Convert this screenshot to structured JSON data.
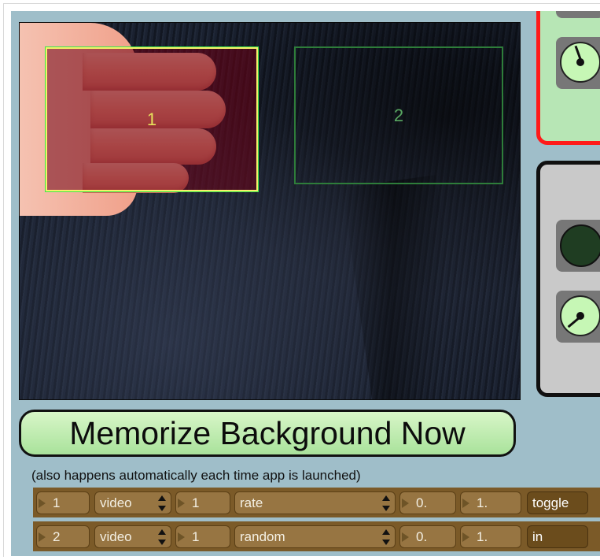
{
  "zones": [
    {
      "label": "1"
    },
    {
      "label": "2"
    }
  ],
  "memorize_button": {
    "label": "Memorize Background Now"
  },
  "note": "(also happens automatically each time app is launched)",
  "rows": [
    {
      "id": "1",
      "source": "video",
      "index": "1",
      "param": "rate",
      "min": "0.",
      "max": "1.",
      "action": "toggle"
    },
    {
      "id": "2",
      "source": "video",
      "index": "1",
      "param": "random",
      "min": "0.",
      "max": "1.",
      "action": "in"
    }
  ],
  "colors": {
    "panel_bg": "#9fbec9",
    "button_green": "#a9e29b",
    "zone_active": "#3ae84a",
    "zone_inactive": "#2e7d3a",
    "row_brown": "#7b5a28",
    "alert_border": "#ff1a1a"
  },
  "icons": {
    "knob": "dial-knob-icon",
    "led": "indicator-led-icon",
    "dropdown": "up-down-arrows-icon",
    "number": "triangle-right-icon"
  }
}
